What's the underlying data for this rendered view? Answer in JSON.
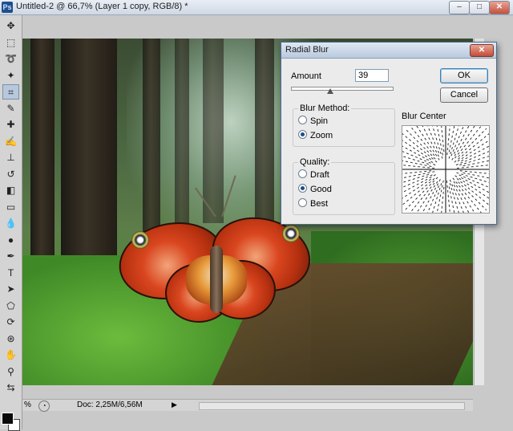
{
  "window": {
    "app_icon": "Ps",
    "title": "Untitled-2 @ 66,7% (Layer 1 copy, RGB/8) *",
    "minimize": "–",
    "maximize": "□",
    "close": "✕"
  },
  "toolbox": {
    "tools": [
      {
        "name": "move-tool-icon",
        "glyph": "✥"
      },
      {
        "name": "marquee-tool-icon",
        "glyph": "⬚"
      },
      {
        "name": "lasso-tool-icon",
        "glyph": "➰"
      },
      {
        "name": "magic-wand-tool-icon",
        "glyph": "✦"
      },
      {
        "name": "crop-tool-icon",
        "glyph": "⌗"
      },
      {
        "name": "eyedropper-tool-icon",
        "glyph": "✎"
      },
      {
        "name": "healing-brush-tool-icon",
        "glyph": "✚"
      },
      {
        "name": "brush-tool-icon",
        "glyph": "✍"
      },
      {
        "name": "clone-stamp-tool-icon",
        "glyph": "⊥"
      },
      {
        "name": "history-brush-tool-icon",
        "glyph": "↺"
      },
      {
        "name": "eraser-tool-icon",
        "glyph": "◧"
      },
      {
        "name": "gradient-tool-icon",
        "glyph": "▭"
      },
      {
        "name": "blur-tool-icon",
        "glyph": "💧"
      },
      {
        "name": "dodge-tool-icon",
        "glyph": "●"
      },
      {
        "name": "pen-tool-icon",
        "glyph": "✒"
      },
      {
        "name": "type-tool-icon",
        "glyph": "T"
      },
      {
        "name": "path-selection-tool-icon",
        "glyph": "➤"
      },
      {
        "name": "shape-tool-icon",
        "glyph": "⬠"
      },
      {
        "name": "3d-rotate-tool-icon",
        "glyph": "⟳"
      },
      {
        "name": "3d-orbit-tool-icon",
        "glyph": "⊛"
      },
      {
        "name": "hand-tool-icon",
        "glyph": "✋"
      },
      {
        "name": "zoom-tool-icon",
        "glyph": "⚲"
      },
      {
        "name": "swap-colors-icon",
        "glyph": "⇆"
      }
    ],
    "foreground_color": "#0a0a0a",
    "background_color": "#ffffff"
  },
  "dialog": {
    "title": "Radial Blur",
    "close": "✕",
    "amount_label": "Amount",
    "amount_value": "39",
    "amount_fraction": 0.39,
    "blur_method_label": "Blur Method:",
    "blur_methods": [
      {
        "label": "Spin",
        "checked": false
      },
      {
        "label": "Zoom",
        "checked": true
      }
    ],
    "quality_label": "Quality:",
    "qualities": [
      {
        "label": "Draft",
        "checked": false
      },
      {
        "label": "Good",
        "checked": true
      },
      {
        "label": "Best",
        "checked": false
      }
    ],
    "ok_label": "OK",
    "cancel_label": "Cancel",
    "blur_center_label": "Blur Center"
  },
  "status_bar": {
    "zoom": "%",
    "doc_info": "Doc: 2,25M/6,56M",
    "arrow": "▶"
  }
}
